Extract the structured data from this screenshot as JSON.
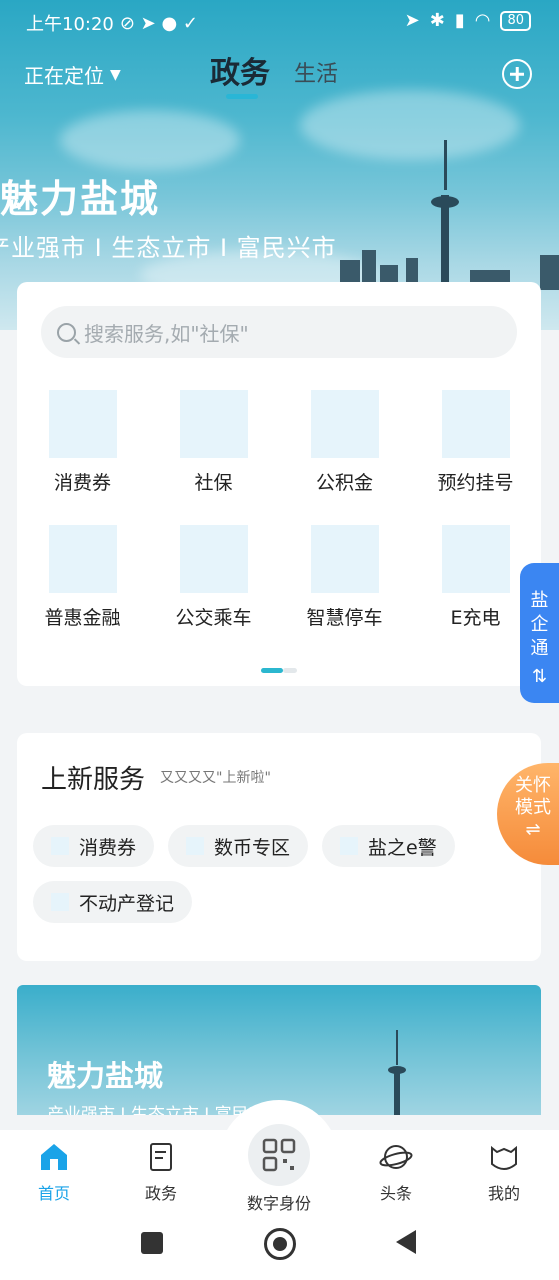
{
  "status": {
    "time": "上午10:20",
    "battery": "80"
  },
  "header": {
    "location": "正在定位",
    "tabs": [
      "政务",
      "生活"
    ]
  },
  "hero": {
    "title": "魅力盐城",
    "subtitle": "产业强市 I 生态立市 I 富民兴市"
  },
  "search": {
    "placeholder": "搜索服务,如\"社保\""
  },
  "services": [
    {
      "label": "消费券"
    },
    {
      "label": "社保"
    },
    {
      "label": "公积金"
    },
    {
      "label": "预约挂号"
    },
    {
      "label": "普惠金融"
    },
    {
      "label": "公交乘车"
    },
    {
      "label": "智慧停车"
    },
    {
      "label": "E充电"
    }
  ],
  "new_services": {
    "title": "上新服务",
    "subtitle": "又又又又\"上新啦\"",
    "chips": [
      {
        "label": "消费券"
      },
      {
        "label": "数币专区"
      },
      {
        "label": "盐之e警"
      },
      {
        "label": "不动产登记"
      }
    ]
  },
  "banner": {
    "title": "魅力盐城",
    "subtitle": "产业强市 I 生态立市 I 富民兴市"
  },
  "side_tab": {
    "label": "盐企通"
  },
  "care_mode": {
    "label": "关怀模式"
  },
  "nav": {
    "items": [
      {
        "label": "首页"
      },
      {
        "label": "政务"
      },
      {
        "label": "数字身份"
      },
      {
        "label": "头条"
      },
      {
        "label": "我的"
      }
    ]
  },
  "colors": {
    "accent": "#29b6d6",
    "side_tab": "#3b86f2",
    "care": "#f58b3a",
    "nav_active": "#1aa3e8"
  }
}
